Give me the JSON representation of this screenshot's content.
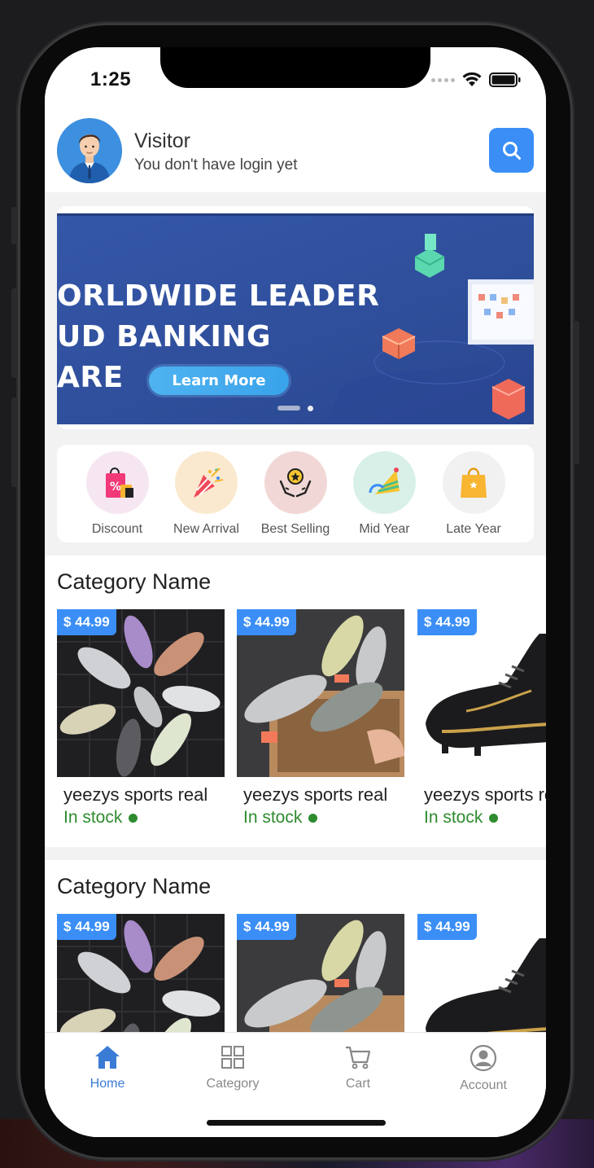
{
  "status": {
    "time": "1:25"
  },
  "header": {
    "name": "Visitor",
    "subtitle": "You don't have login yet",
    "avatar_icon": "avatar-man-icon",
    "search_icon": "search-icon"
  },
  "banner": {
    "lines": [
      "ORLDWIDE LEADER",
      "UD BANKING",
      "ARE"
    ],
    "button_label": "Learn More",
    "active_slide": 1,
    "slide_count": 2
  },
  "quick_categories": [
    {
      "label": "Discount",
      "icon": "discount-bag-icon",
      "bg": "#f6e6f2"
    },
    {
      "label": "New Arrival",
      "icon": "party-popper-icon",
      "bg": "#fbe9cf"
    },
    {
      "label": "Best Selling",
      "icon": "award-hands-icon",
      "bg": "#f1d8d6"
    },
    {
      "label": "Mid Year",
      "icon": "party-hat-icon",
      "bg": "#d8f0e8"
    },
    {
      "label": "Late Year",
      "icon": "shopping-bag-icon",
      "bg": "#f1f1f1"
    }
  ],
  "sections": [
    {
      "title": "Category Name",
      "products": [
        {
          "price": "$ 44.99",
          "name": "yeezys sports real",
          "stock": "In stock"
        },
        {
          "price": "$ 44.99",
          "name": "yeezys sports real",
          "stock": "In stock"
        },
        {
          "price": "$ 44.99",
          "name": "yeezys sports real",
          "stock": "In stock"
        }
      ]
    },
    {
      "title": "Category Name",
      "products": [
        {
          "price": "$ 44.99"
        },
        {
          "price": "$ 44.99"
        },
        {
          "price": "$ 44.99"
        }
      ]
    }
  ],
  "tabbar": [
    {
      "label": "Home",
      "icon": "home-icon",
      "active": true
    },
    {
      "label": "Category",
      "icon": "grid-icon",
      "active": false
    },
    {
      "label": "Cart",
      "icon": "cart-icon",
      "active": false
    },
    {
      "label": "Account",
      "icon": "account-icon",
      "active": false
    }
  ],
  "colors": {
    "accent": "#3a8ef6",
    "in_stock": "#2e8b2e",
    "tab_active": "#3a7bd5"
  }
}
